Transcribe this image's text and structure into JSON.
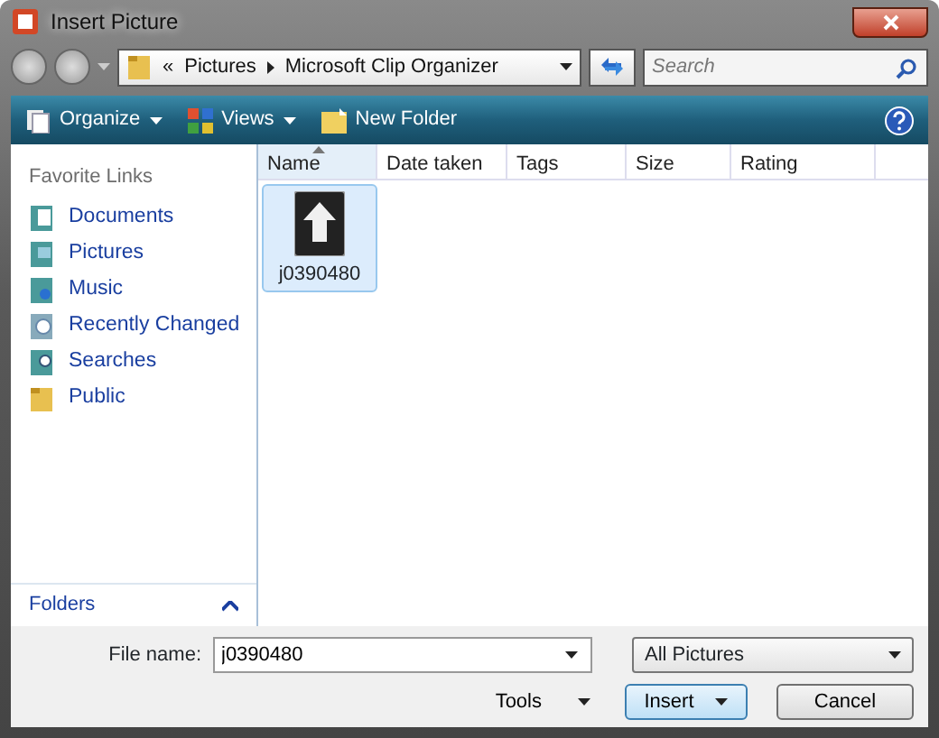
{
  "window": {
    "title": "Insert Picture"
  },
  "address": {
    "overflow": "«",
    "path": [
      {
        "label": "Pictures"
      },
      {
        "label": "Microsoft Clip Organizer"
      }
    ]
  },
  "search": {
    "placeholder": "Search"
  },
  "toolbar": [
    {
      "label": "Organize",
      "kind": "menu"
    },
    {
      "label": "Views",
      "kind": "menu"
    },
    {
      "label": "New Folder",
      "kind": "plain"
    }
  ],
  "sidebar": {
    "heading": "Favorite Links",
    "footer": "Folders",
    "items": [
      {
        "label": "Documents",
        "kind": "documents"
      },
      {
        "label": "Pictures",
        "kind": "pictures"
      },
      {
        "label": "Music",
        "kind": "music"
      },
      {
        "label": "Recently Changed",
        "kind": "recent"
      },
      {
        "label": "Searches",
        "kind": "searches"
      },
      {
        "label": "Public",
        "kind": "folder"
      }
    ]
  },
  "columns": [
    {
      "label": "Name",
      "sorted": true
    },
    {
      "label": "Date taken",
      "sorted": false
    },
    {
      "label": "Tags",
      "sorted": false
    },
    {
      "label": "Size",
      "sorted": false
    },
    {
      "label": "Rating",
      "sorted": false
    }
  ],
  "files": [
    {
      "name": "j0390480",
      "selected": true
    }
  ],
  "file_name": {
    "label": "File name:",
    "value": "j0390480"
  },
  "file_type": {
    "value": "All Pictures"
  },
  "buttons": [
    {
      "label": "Tools",
      "kind": "menu"
    },
    {
      "label": "Insert",
      "kind": "split"
    },
    {
      "label": "Cancel",
      "kind": "plain"
    }
  ]
}
